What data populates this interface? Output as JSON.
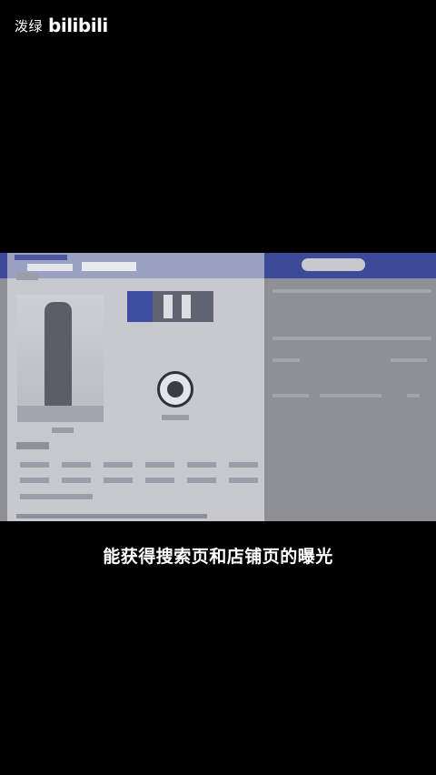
{
  "watermark": {
    "account": "泼绿",
    "platform": "bilibili"
  },
  "subtitle": "能获得搜索页和店铺页的曝光",
  "colors": {
    "background": "#000000",
    "recording_blue": "#3d4a9a",
    "recording_grey": "#8f8f96",
    "text": "#ffffff"
  }
}
